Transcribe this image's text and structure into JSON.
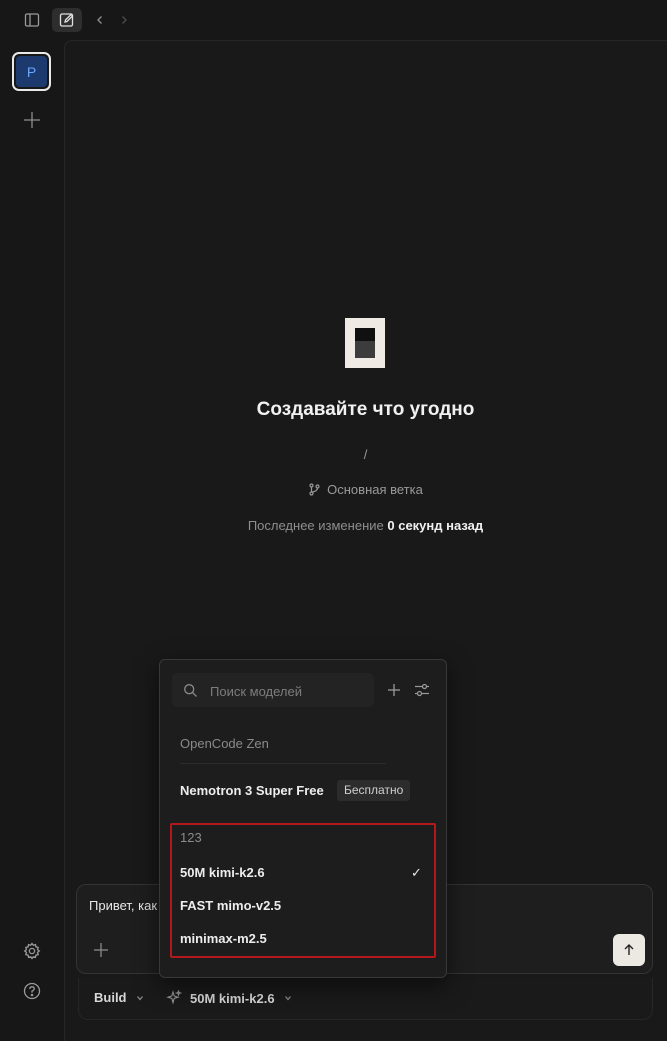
{
  "empty_state": {
    "title": "Создавайте что угодно",
    "path": "/",
    "branch": "Основная ветка",
    "modified_label": "Последнее изменение",
    "modified_value": "0 секунд назад"
  },
  "sidebar": {
    "project_initial": "P"
  },
  "composer": {
    "text": "Привет, как дела?",
    "mode": "Build",
    "model": "50M kimi-k2.6"
  },
  "model_picker": {
    "search_placeholder": "Поиск моделей",
    "groups": [
      {
        "label": "OpenCode Zen",
        "models": [
          {
            "name": "Nemotron 3 Super Free",
            "badge": "Бесплатно"
          }
        ]
      },
      {
        "label": "123",
        "models": [
          {
            "name": "50M kimi-k2.6",
            "selected": true
          },
          {
            "name": "FAST mimo-v2.5"
          },
          {
            "name": "minimax-m2.5"
          }
        ]
      }
    ],
    "check_mark": "✓"
  },
  "colors": {
    "background": "#171717",
    "highlight_border": "#b3191c",
    "avatar_bg": "#1d3a6e",
    "avatar_text": "#6aa6ff"
  }
}
